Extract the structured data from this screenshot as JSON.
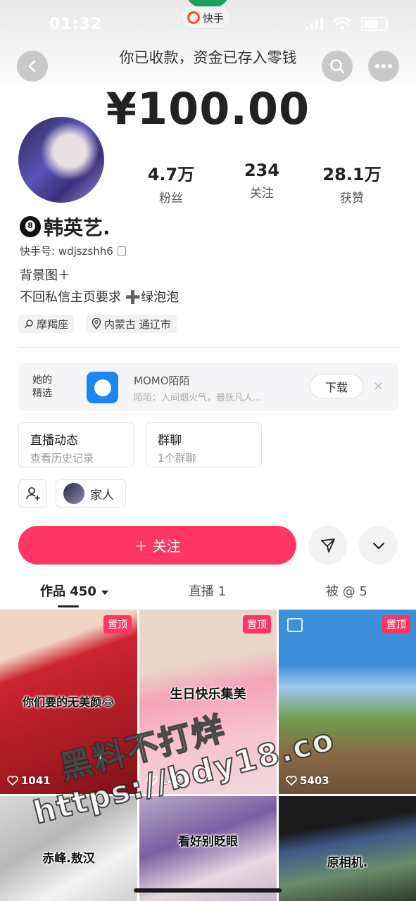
{
  "status_bar": {
    "time": "01:32"
  },
  "app_pill": {
    "label": "快手"
  },
  "header": {
    "banner": "你已收款，资金已存入零钱",
    "amount": "¥100.00"
  },
  "profile": {
    "stats": [
      {
        "value": "4.7万",
        "label": "粉丝"
      },
      {
        "value": "234",
        "label": "关注"
      },
      {
        "value": "28.1万",
        "label": "获赞"
      }
    ],
    "name": "韩英艺.",
    "kuaishou_id": "快手号: wdjszshh6",
    "bio_lines": [
      "背景图＋",
      "不回私信主页要求 ➕绿泡泡"
    ],
    "tags": [
      "摩羯座",
      "内蒙古 通辽市"
    ]
  },
  "promo": {
    "label": "她的 精选",
    "app_title": "MOMO陌陌",
    "app_desc": "陌陌：人间烟火气，最抚凡人...",
    "download": "下载",
    "close": "×"
  },
  "cards": [
    {
      "title": "直播动态",
      "sub": "查看历史记录"
    },
    {
      "title": "群聊",
      "sub": "1个群聊"
    }
  ],
  "group_chip": {
    "label": "家人"
  },
  "actions": {
    "follow": "＋ 关注"
  },
  "tabs": [
    "作品 450",
    "直播 1",
    "被 @ 5"
  ],
  "grid": [
    {
      "pinned": "置顶",
      "caption": "你们要的无美颜😂",
      "likes": "1041"
    },
    {
      "pinned": "置顶",
      "caption": "生日快乐集美",
      "likes": "1428"
    },
    {
      "pinned": "置顶",
      "caption": "",
      "likes": "5403"
    },
    {
      "caption": "赤峰.敖汉"
    },
    {
      "caption": "看好别眨眼"
    },
    {
      "caption": "原相机."
    }
  ],
  "watermark": {
    "line1": "黑料不打烊",
    "line2": "https://bdy18.co"
  }
}
